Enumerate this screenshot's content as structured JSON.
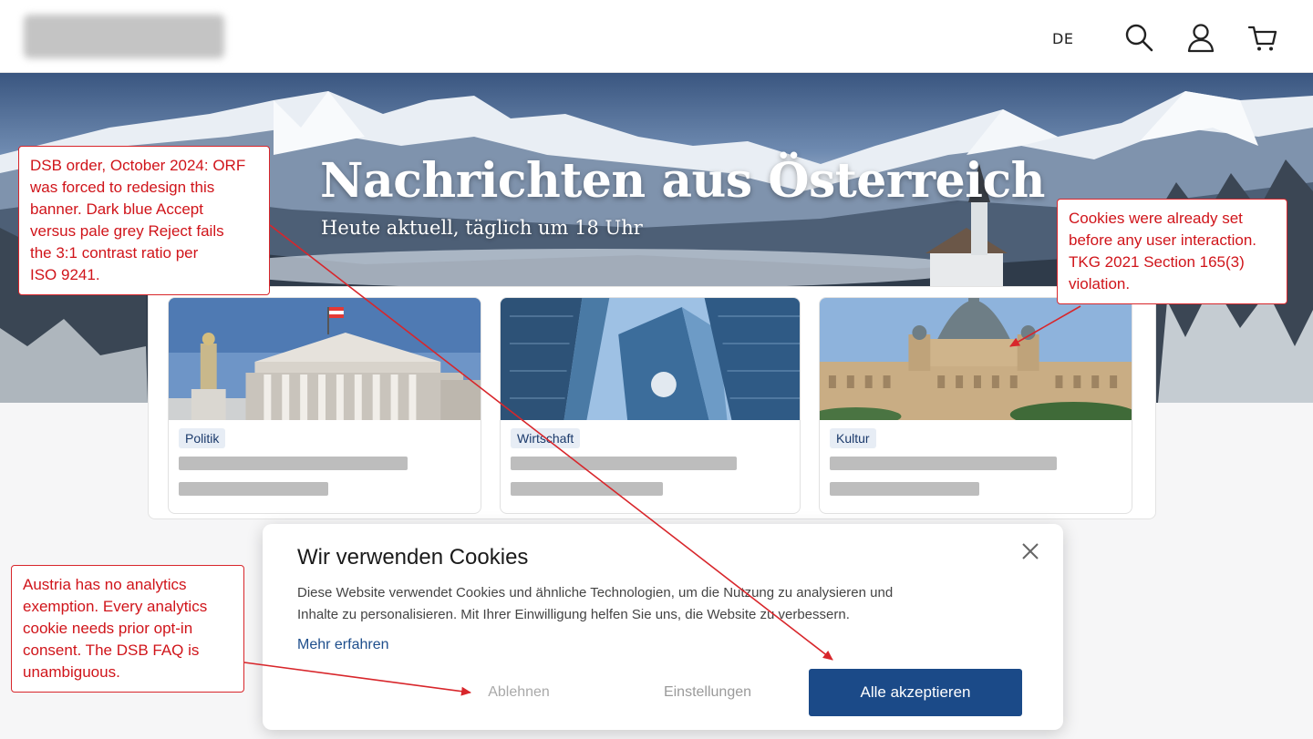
{
  "header": {
    "language": "DE",
    "icons": [
      "search-icon",
      "user-icon",
      "cart-icon"
    ]
  },
  "hero": {
    "title": "Nachrichten aus Österreich",
    "subtitle": "Heute aktuell, täglich um 18 Uhr"
  },
  "cards": [
    {
      "tag": "Politik"
    },
    {
      "tag": "Wirtschaft"
    },
    {
      "tag": "Kultur"
    }
  ],
  "cookie_banner": {
    "title": "Wir verwenden Cookies",
    "body_line1": "Diese Website verwendet Cookies und ähnliche Technologien, um die Nutzung zu analysieren und",
    "body_line2": "Inhalte zu personalisieren. Mit Ihrer Einwilligung helfen Sie uns, die Website zu verbessern.",
    "learn_more": "Mehr erfahren",
    "reject_label": "Ablehnen",
    "settings_label": "Einstellungen",
    "accept_label": "Alle akzeptieren"
  },
  "annotations": {
    "dsb_order": [
      "DSB order, October 2024: ORF",
      "was forced to redesign this",
      "banner. Dark blue Accept",
      "versus pale grey Reject fails",
      "the 3:1 contrast ratio per",
      "ISO 9241."
    ],
    "cookies_set": [
      "Cookies were already set",
      "before any user interaction.",
      "TKG 2021 Section 165(3)",
      "violation."
    ],
    "analytics": [
      "Austria has no analytics",
      "exemption. Every analytics",
      "cookie needs prior opt-in",
      "consent. The DSB FAQ is",
      "unambiguous."
    ]
  },
  "colors": {
    "accept_button": "#1b4a88",
    "reject_text": "#a9a9a9",
    "annotation_red": "#d0141a",
    "tag_background": "#e7edf5"
  }
}
